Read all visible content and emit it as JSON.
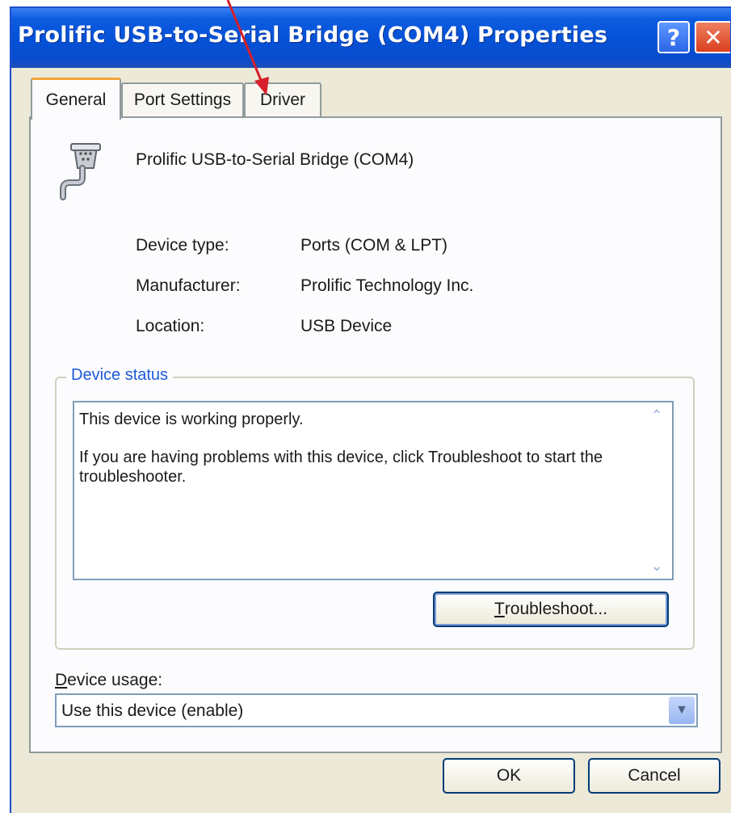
{
  "window": {
    "title": "Prolific USB-to-Serial Bridge (COM4) Properties",
    "help_glyph": "?",
    "close_glyph": "✕"
  },
  "tabs": [
    {
      "label": "General",
      "active": true
    },
    {
      "label": "Port Settings",
      "active": false
    },
    {
      "label": "Driver",
      "active": false
    }
  ],
  "device": {
    "icon": "serial-port-icon",
    "name": "Prolific USB-to-Serial Bridge (COM4)"
  },
  "properties": [
    {
      "label": "Device type:",
      "value": "Ports (COM & LPT)"
    },
    {
      "label": "Manufacturer:",
      "value": "Prolific Technology Inc."
    },
    {
      "label": "Location:",
      "value": "USB Device"
    }
  ],
  "status": {
    "legend": "Device status",
    "line1": "This device is working properly.",
    "line2": "If you are having problems with this device, click Troubleshoot to start the troubleshooter."
  },
  "buttons": {
    "troubleshoot_first": "T",
    "troubleshoot_rest": "roubleshoot...",
    "ok": "OK",
    "cancel": "Cancel"
  },
  "usage": {
    "label_first": "D",
    "label_rest": "evice usage:",
    "selected": "Use this device (enable)"
  },
  "colors": {
    "titlebar": "#0551d6",
    "annotation_arrow": "#d6202c",
    "tab_highlight": "#f3a535"
  }
}
